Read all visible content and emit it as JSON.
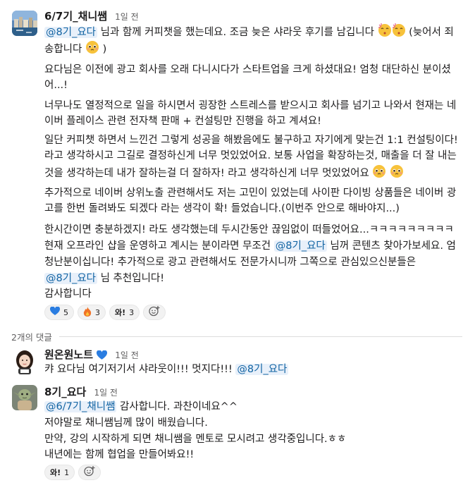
{
  "main_post": {
    "author": "6/7기_채니쌤",
    "time": "1일 전",
    "lines": [
      {
        "pre": "",
        "mention": "@8기_요다",
        "post": " 님과 함께 커피챗을 했는데요. 조금 늦은 샤라웃 후기를 남깁니다 ",
        "tail": " (늦어서 죄"
      },
      {
        "text": "송합니다 ",
        "tail": " )"
      },
      {
        "text": "요다님은 이전에 광고 회사를 오래 다니시다가 스타트업을 크게 하셨대요! 엄청 대단하신 분이셨"
      },
      {
        "text": "어...!"
      },
      {
        "text": "너무나도 열정적으로 일을 하시면서 굉장한 스트레스를 받으시고 회사를 넘기고 나와서 현재는 네"
      },
      {
        "text": "이버 플레이스 관련 전자책 판매 + 컨설팅만 진행을 하고 계셔요!"
      },
      {
        "text": "일단 커피챗 하면서 느낀건 그렇게 성공을 해봤음에도 불구하고 자기에게 맞는건 1:1 컨설팅이다!"
      },
      {
        "text": "라고 생각하시고 그길로 결정하신게 너무 멋있었어요. 보통 사업을 확장하는것, 매출을 더 잘 내는"
      },
      {
        "text": "것을 생각하는데 내가 잘하는걸 더 잘하자! 라고 생각하신게 너무 멋있었어요 "
      },
      {
        "text": "추가적으로 네이버 상위노출 관련해서도 저는 고민이 있었는데 사이판 다이빙 상품들은 네이버 광"
      },
      {
        "text": "고를 한번 돌려봐도 되겠다 라는 생각이 확! 들었습니다.(이번주 안으로 해바야지...)"
      },
      {
        "text": "한시간이면 충분하겠지! 라도 생각했는데 두시간동안 끊임없이 떠들었어요...ㅋㅋㅋㅋㅋㅋㅋㅋㅋ"
      },
      {
        "pre": "현재 오프라인 샵을 운영하고 계시는 분이라면 무조건 ",
        "mention": "@8기_요다",
        "post": " 님꺼 콘텐츠 찾아가보세요. 엄"
      },
      {
        "text": "청난분이십니다! 추가적으로 광고 관련해서도 전문가시니까 그쪽으로 관심있으신분들은"
      },
      {
        "pre": "",
        "mention": "@8기_요다",
        "post": " 님 추천입니다!"
      },
      {
        "text": "감사합니다"
      }
    ],
    "reactions": [
      {
        "emoji": "💙",
        "count": "5",
        "color": "#1d6fd6"
      },
      {
        "emoji": "🔥",
        "count": "3",
        "color": "#e8612c"
      },
      {
        "emoji": "와!",
        "count": "3"
      }
    ]
  },
  "replies_label": "2개의 댓글",
  "reply1": {
    "author": "원온원노트",
    "badge": "💙",
    "time": "1일 전",
    "pre": "캬 요다님 여기저기서 샤라웃이!!! 멋지다!!! ",
    "mention": "@8기_요다"
  },
  "reply2": {
    "author": "8기_요다",
    "time": "1일 전",
    "mention": "@6/7기_채니쌤",
    "first_post": " 감사합니다. 과찬이네요^^",
    "lines": [
      "저야말로 채니쌤님께 많이 배웠습니다.",
      "만약, 강의 시작하게 되면 채니쌤을 멘토로 모시려고 생각중입니다.ㅎㅎ",
      "내년에는 함께 협업을 만들어봐요!!"
    ],
    "reactions": [
      {
        "emoji": "와!",
        "count": "1"
      }
    ]
  },
  "colors": {
    "mention": "#1264a3",
    "mention_bg": "#e8f0fa",
    "muted": "#616061"
  },
  "icons": [
    "avatar-harbor",
    "avatar-person",
    "avatar-yoda",
    "face-kiss-icon",
    "pleading-face-icon",
    "add-reaction-icon"
  ]
}
